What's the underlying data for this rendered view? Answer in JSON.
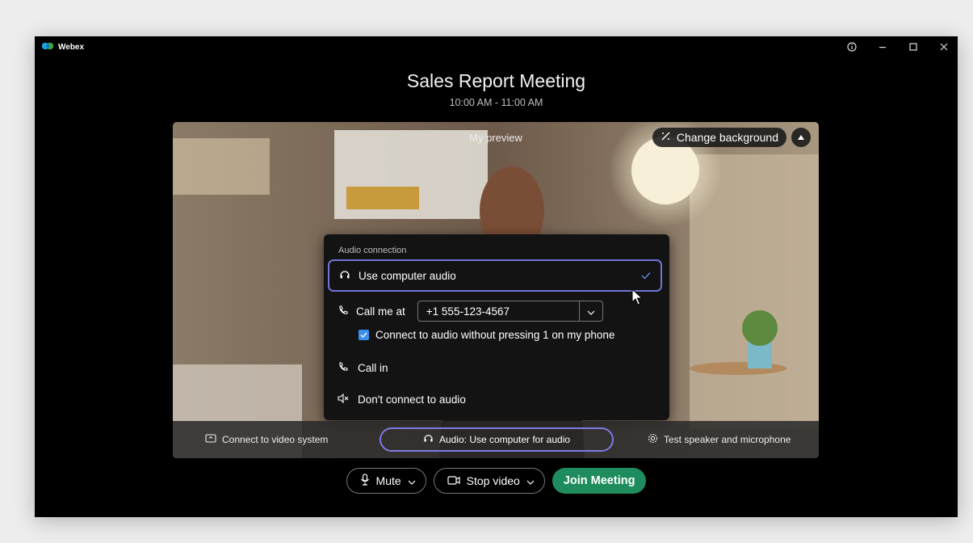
{
  "app": {
    "name": "Webex",
    "logo_icon": "webex-logo-icon"
  },
  "window_controls": {
    "icons": [
      "info-icon",
      "minimize-icon",
      "maximize-icon",
      "close-icon"
    ]
  },
  "meeting": {
    "title": "Sales Report Meeting",
    "time": "10:00 AM - 11:00 AM"
  },
  "preview": {
    "label": "My preview",
    "change_background_label": "Change background"
  },
  "audio_panel": {
    "title": "Audio connection",
    "options": {
      "use_computer": "Use computer audio",
      "call_me_label": "Call me at",
      "phone_number": "+1 555-123-4567",
      "checkbox_label": "Connect to audio without pressing 1 on my phone",
      "call_in": "Call in",
      "dont_connect": "Don't connect to audio"
    },
    "selected": "use_computer"
  },
  "bottom_strip": {
    "video_system": "Connect to video system",
    "audio_status": "Audio: Use computer for audio",
    "test_speaker": "Test speaker and microphone"
  },
  "controls": {
    "mute": "Mute",
    "stop_video": "Stop video",
    "join": "Join Meeting"
  },
  "colors": {
    "accent": "#6f74d9",
    "join": "#1f8c5d",
    "checkbox": "#3b8ff0",
    "window_bg": "#000000"
  }
}
